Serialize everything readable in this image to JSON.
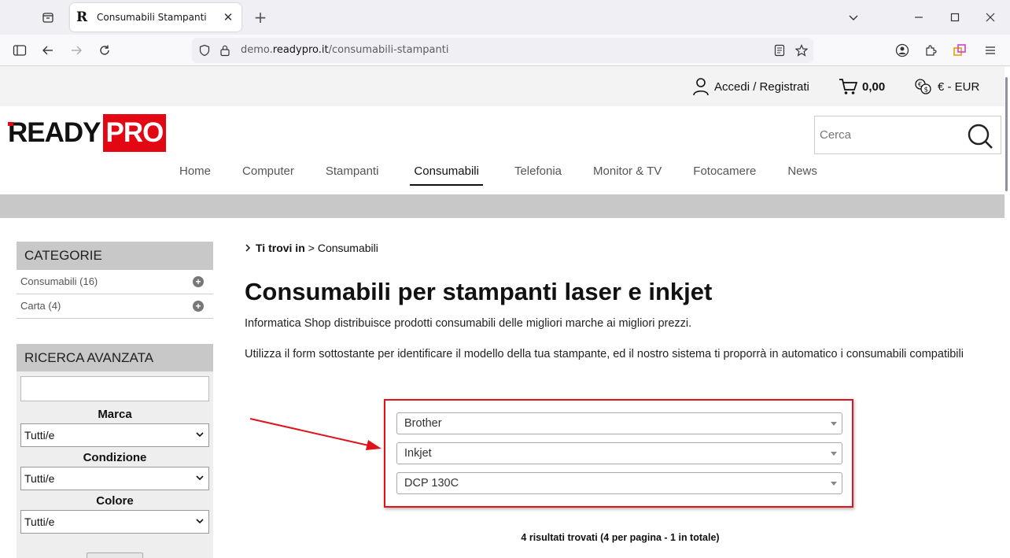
{
  "browser": {
    "tab_title": "Consumabili Stampanti",
    "url_host": "demo.readypro.it",
    "url_path": "/consumabili-stampanti",
    "url_prefix": "demo.",
    "url_domain": "readypro.it"
  },
  "topbar": {
    "login": "Accedi / Registrati",
    "cart_total": "0,00",
    "currency": "€ - EUR"
  },
  "logo": {
    "part1": "READY",
    "part2": "PRO"
  },
  "search": {
    "placeholder": "Cerca"
  },
  "nav": {
    "items": [
      "Home",
      "Computer",
      "Stampanti",
      "Consumabili",
      "Telefonia",
      "Monitor & TV",
      "Fotocamere",
      "News"
    ],
    "active": "Consumabili"
  },
  "sidebar": {
    "categories_title": "CATEGORIE",
    "categories": [
      {
        "label": "Consumabili (16)"
      },
      {
        "label": "Carta (4)"
      }
    ],
    "advanced_title": "RICERCA AVANZATA",
    "filters": [
      {
        "label": "Marca",
        "value": "Tutti/e"
      },
      {
        "label": "Condizione",
        "value": "Tutti/e"
      },
      {
        "label": "Colore",
        "value": "Tutti/e"
      }
    ]
  },
  "breadcrumb": {
    "prefix": "Ti trovi in",
    "separator": ">",
    "current": "Consumabili"
  },
  "content": {
    "title": "Consumabili per stampanti laser e inkjet",
    "intro": "Informatica Shop distribuisce prodotti consumabili delle migliori marche ai migliori prezzi.",
    "instructions": "Utilizza il form sottostante per identificare il modello della tua stampante, ed il nostro sistema ti proporrà in automatico i consumabili compatibili"
  },
  "printer_finder": {
    "brand": "Brother",
    "type": "Inkjet",
    "model": "DCP 130C"
  },
  "results": {
    "summary": "4 risultati trovati (4 per pagina - 1 in totale)"
  },
  "colors": {
    "accent_red": "#e30613",
    "annotation_red": "#e0131b",
    "sidebar_header": "#c8c8c8"
  }
}
